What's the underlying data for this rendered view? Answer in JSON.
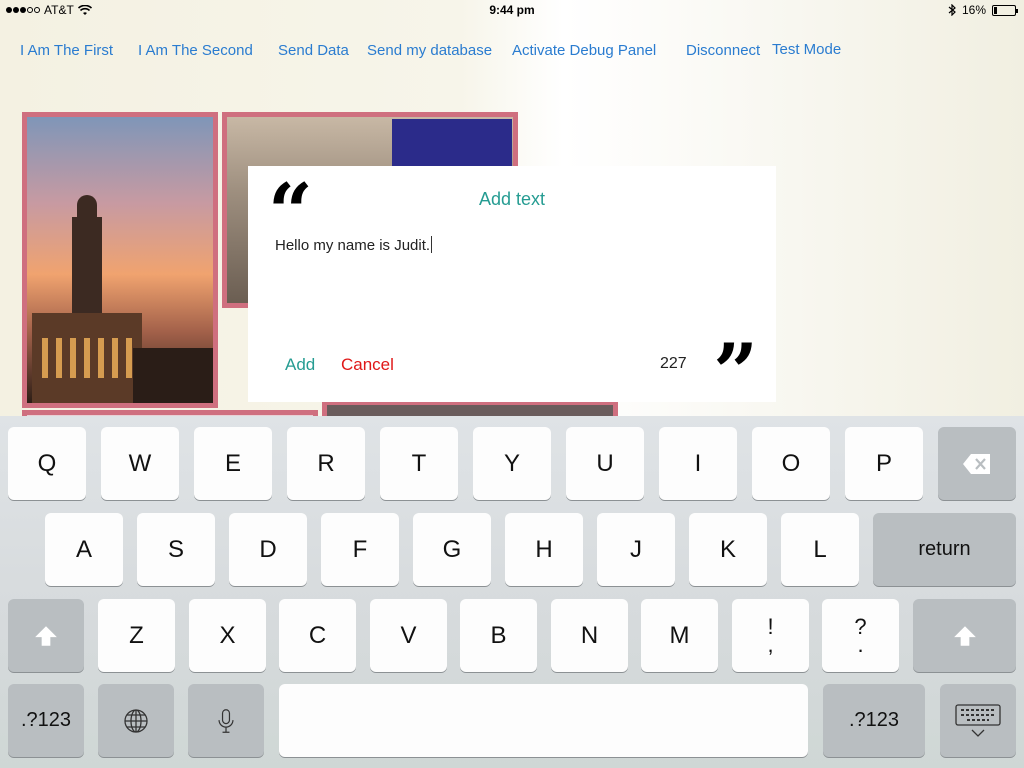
{
  "status_bar": {
    "carrier": "AT&T",
    "time": "9:44 pm",
    "battery": "16%",
    "battery_level": 0.16
  },
  "nav_links": [
    "I Am The First",
    "I Am The Second",
    "Send Data",
    "Send my database",
    "Activate Debug Panel",
    "Disconnect",
    "Test Mode"
  ],
  "dialog": {
    "title": "Add text",
    "text": "Hello my name is Judit.",
    "add_label": "Add",
    "cancel_label": "Cancel",
    "char_count": "227",
    "open_quote": "“",
    "close_quote": "”"
  },
  "keyboard": {
    "row1": [
      "Q",
      "W",
      "E",
      "R",
      "T",
      "Y",
      "U",
      "I",
      "O",
      "P"
    ],
    "row2": [
      "A",
      "S",
      "D",
      "F",
      "G",
      "H",
      "J",
      "K",
      "L"
    ],
    "return_label": "return",
    "row3": [
      "Z",
      "X",
      "C",
      "V",
      "B",
      "N",
      "M"
    ],
    "punct1_top": "!",
    "punct1_bottom": ",",
    "punct2_top": "?",
    "punct2_bottom": ".",
    "numbers_label": ".?123",
    "icons": [
      "shift-icon",
      "delete-icon",
      "globe-icon",
      "microphone-icon",
      "hide-keyboard-icon"
    ]
  },
  "colors": {
    "link": "#2a7cd0",
    "accent": "#259c92",
    "cancel": "#e01818",
    "photo_border": "#cf6f7f"
  }
}
